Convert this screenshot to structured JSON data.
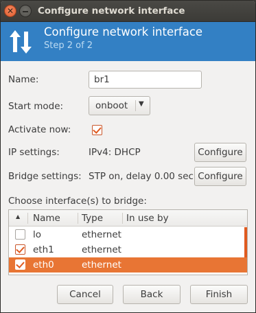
{
  "window": {
    "title": "Configure network interface"
  },
  "header": {
    "title": "Configure network interface",
    "step": "Step 2 of 2"
  },
  "form": {
    "name_label": "Name:",
    "name_value": "br1",
    "start_mode_label": "Start mode:",
    "start_mode_value": "onboot",
    "activate_label": "Activate now:",
    "activate_checked": true,
    "ip_label": "IP settings:",
    "ip_value": "IPv4: DHCP",
    "ip_configure": "Configure",
    "bridge_label": "Bridge settings:",
    "bridge_value": "STP on, delay 0.00 sec",
    "bridge_configure": "Configure",
    "choose_label": "Choose interface(s) to bridge:"
  },
  "table": {
    "columns": [
      "Name",
      "Type",
      "In use by"
    ],
    "rows": [
      {
        "checked": false,
        "name": "lo",
        "type": "ethernet",
        "in_use_by": "",
        "selected": false
      },
      {
        "checked": true,
        "name": "eth1",
        "type": "ethernet",
        "in_use_by": "",
        "selected": false
      },
      {
        "checked": true,
        "name": "eth0",
        "type": "ethernet",
        "in_use_by": "",
        "selected": true
      }
    ]
  },
  "buttons": {
    "cancel": "Cancel",
    "back": "Back",
    "finish": "Finish"
  },
  "colors": {
    "header_bg": "#3380c4",
    "selection": "#e87534",
    "accent": "#e05a1f"
  },
  "icons": {
    "header": "transfer-arrows-icon",
    "close": "close-icon",
    "minimize": "minimize-icon",
    "dropdown": "chevron-down-icon",
    "sort": "sort-up-icon"
  }
}
